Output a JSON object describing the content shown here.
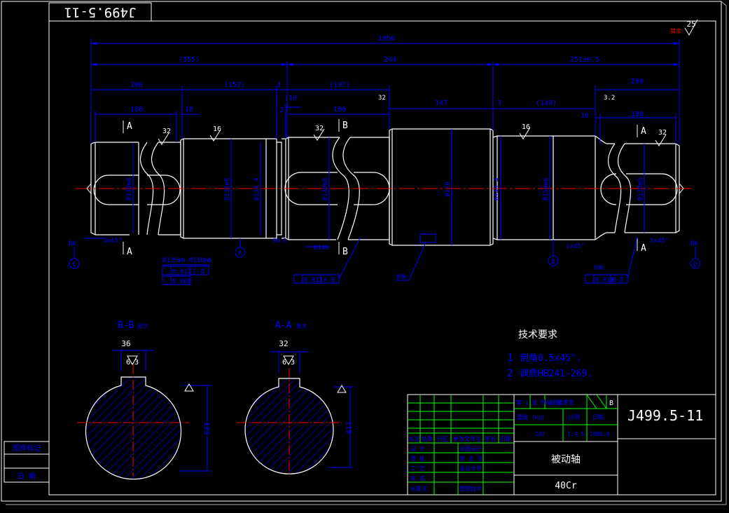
{
  "drawing_code_rotated": "J499.5-11",
  "roughness_general": "25",
  "roughness_note": "其余",
  "dims": {
    "total": "1050",
    "seg_355": "(355)",
    "seg_244": "244",
    "seg_251": "251±0.5",
    "d200_left": "200",
    "d152": "(152)",
    "d3a": "3",
    "d10a": "10",
    "d197": "(197)",
    "d2": "2",
    "d190": "190",
    "d147": "147",
    "d3b": "3",
    "d149": "(149)",
    "d10b": "10",
    "d180_right": "180",
    "d200_right": "200",
    "d180_left": "180",
    "d18": "18"
  },
  "labels": {
    "sec_a1": "A",
    "sec_a2": "A",
    "sec_a3": "A",
    "sec_a4": "A",
    "sec_b1": "B",
    "sec_b2": "B",
    "r32a": "32",
    "r16a": "16",
    "r32b": "32",
    "r16b": "16",
    "r32c": "32",
    "r32d": "32",
    "r32e": "3.2",
    "dia_130": "Ø130m6",
    "dia_135": "Ø135m6",
    "dia_134": "Ø134.4",
    "dia_140": "Ø140m6",
    "dia_170": "Ø170",
    "dia_149": "Ø149.4",
    "dia_150": "Ø150m6",
    "dia_130b": "Ø130m6",
    "chamfer_l": "3x45°",
    "chamfer_r": "3x45°",
    "chamfer_m": "1x45°",
    "b6_left": "B6",
    "b6_right": "B6",
    "circ_c": "C",
    "circ_a": "A",
    "circ_b": "B",
    "circ_d": "D",
    "fit_135": "Ø135m6",
    "fit_150": "Ø150m6",
    "tol_1": "0.012",
    "tol_1_ref": "C-D",
    "tol_2": "0.008",
    "tol_3": "0.012",
    "tol_3_ref": "A-B",
    "tol_4": "0.016",
    "tol_4_ref": "B-D",
    "flat_140": "Ø140",
    "r05": "R0.5",
    "note_mid": "倒角",
    "note_right": "倒角"
  },
  "sections": {
    "bb_title": "B-B",
    "bb_note": "放大",
    "bb_key": "36",
    "bb_rough": "6.3",
    "bb_dim": "123",
    "aa_title": "A-A",
    "aa_note": "放大",
    "aa_key": "32",
    "aa_rough": "6.3",
    "aa_dim": "119"
  },
  "tech": {
    "title": "技术要求",
    "item1_num": "1",
    "item1": "倒角0.5x45°.",
    "item2_num": "2",
    "item2": "调质HB241-269."
  },
  "title_block": {
    "drawing_code": "J499.5-11",
    "part_name": "被动轴",
    "material": "40Cr",
    "sheet_info": "第 1 张 共 1 张",
    "scale_label": "标准化审定",
    "b_mark": "B",
    "weight": "重量 (kg)",
    "ratio": "比例",
    "date": "日期",
    "v_weight": "182",
    "v_ratio": "1:4.5",
    "v_date": "1996.9",
    "h_mark": "标记",
    "h_count": "处数",
    "h_zone": "分区",
    "h_doc": "更改文件号",
    "h_sign": "签名",
    "h_dt": "日期",
    "r_design": "设 计",
    "r_check": "审 核",
    "r_proc": "工 艺",
    "r_appr": "批 准",
    "r_std": "标准化",
    "r_c1": "总图设计",
    "r_c2": "室 主 任",
    "r_c3": "总设计师",
    "r_c4": "管理技术"
  },
  "side_block": {
    "label1": "图样标记",
    "label2": "日 期"
  }
}
